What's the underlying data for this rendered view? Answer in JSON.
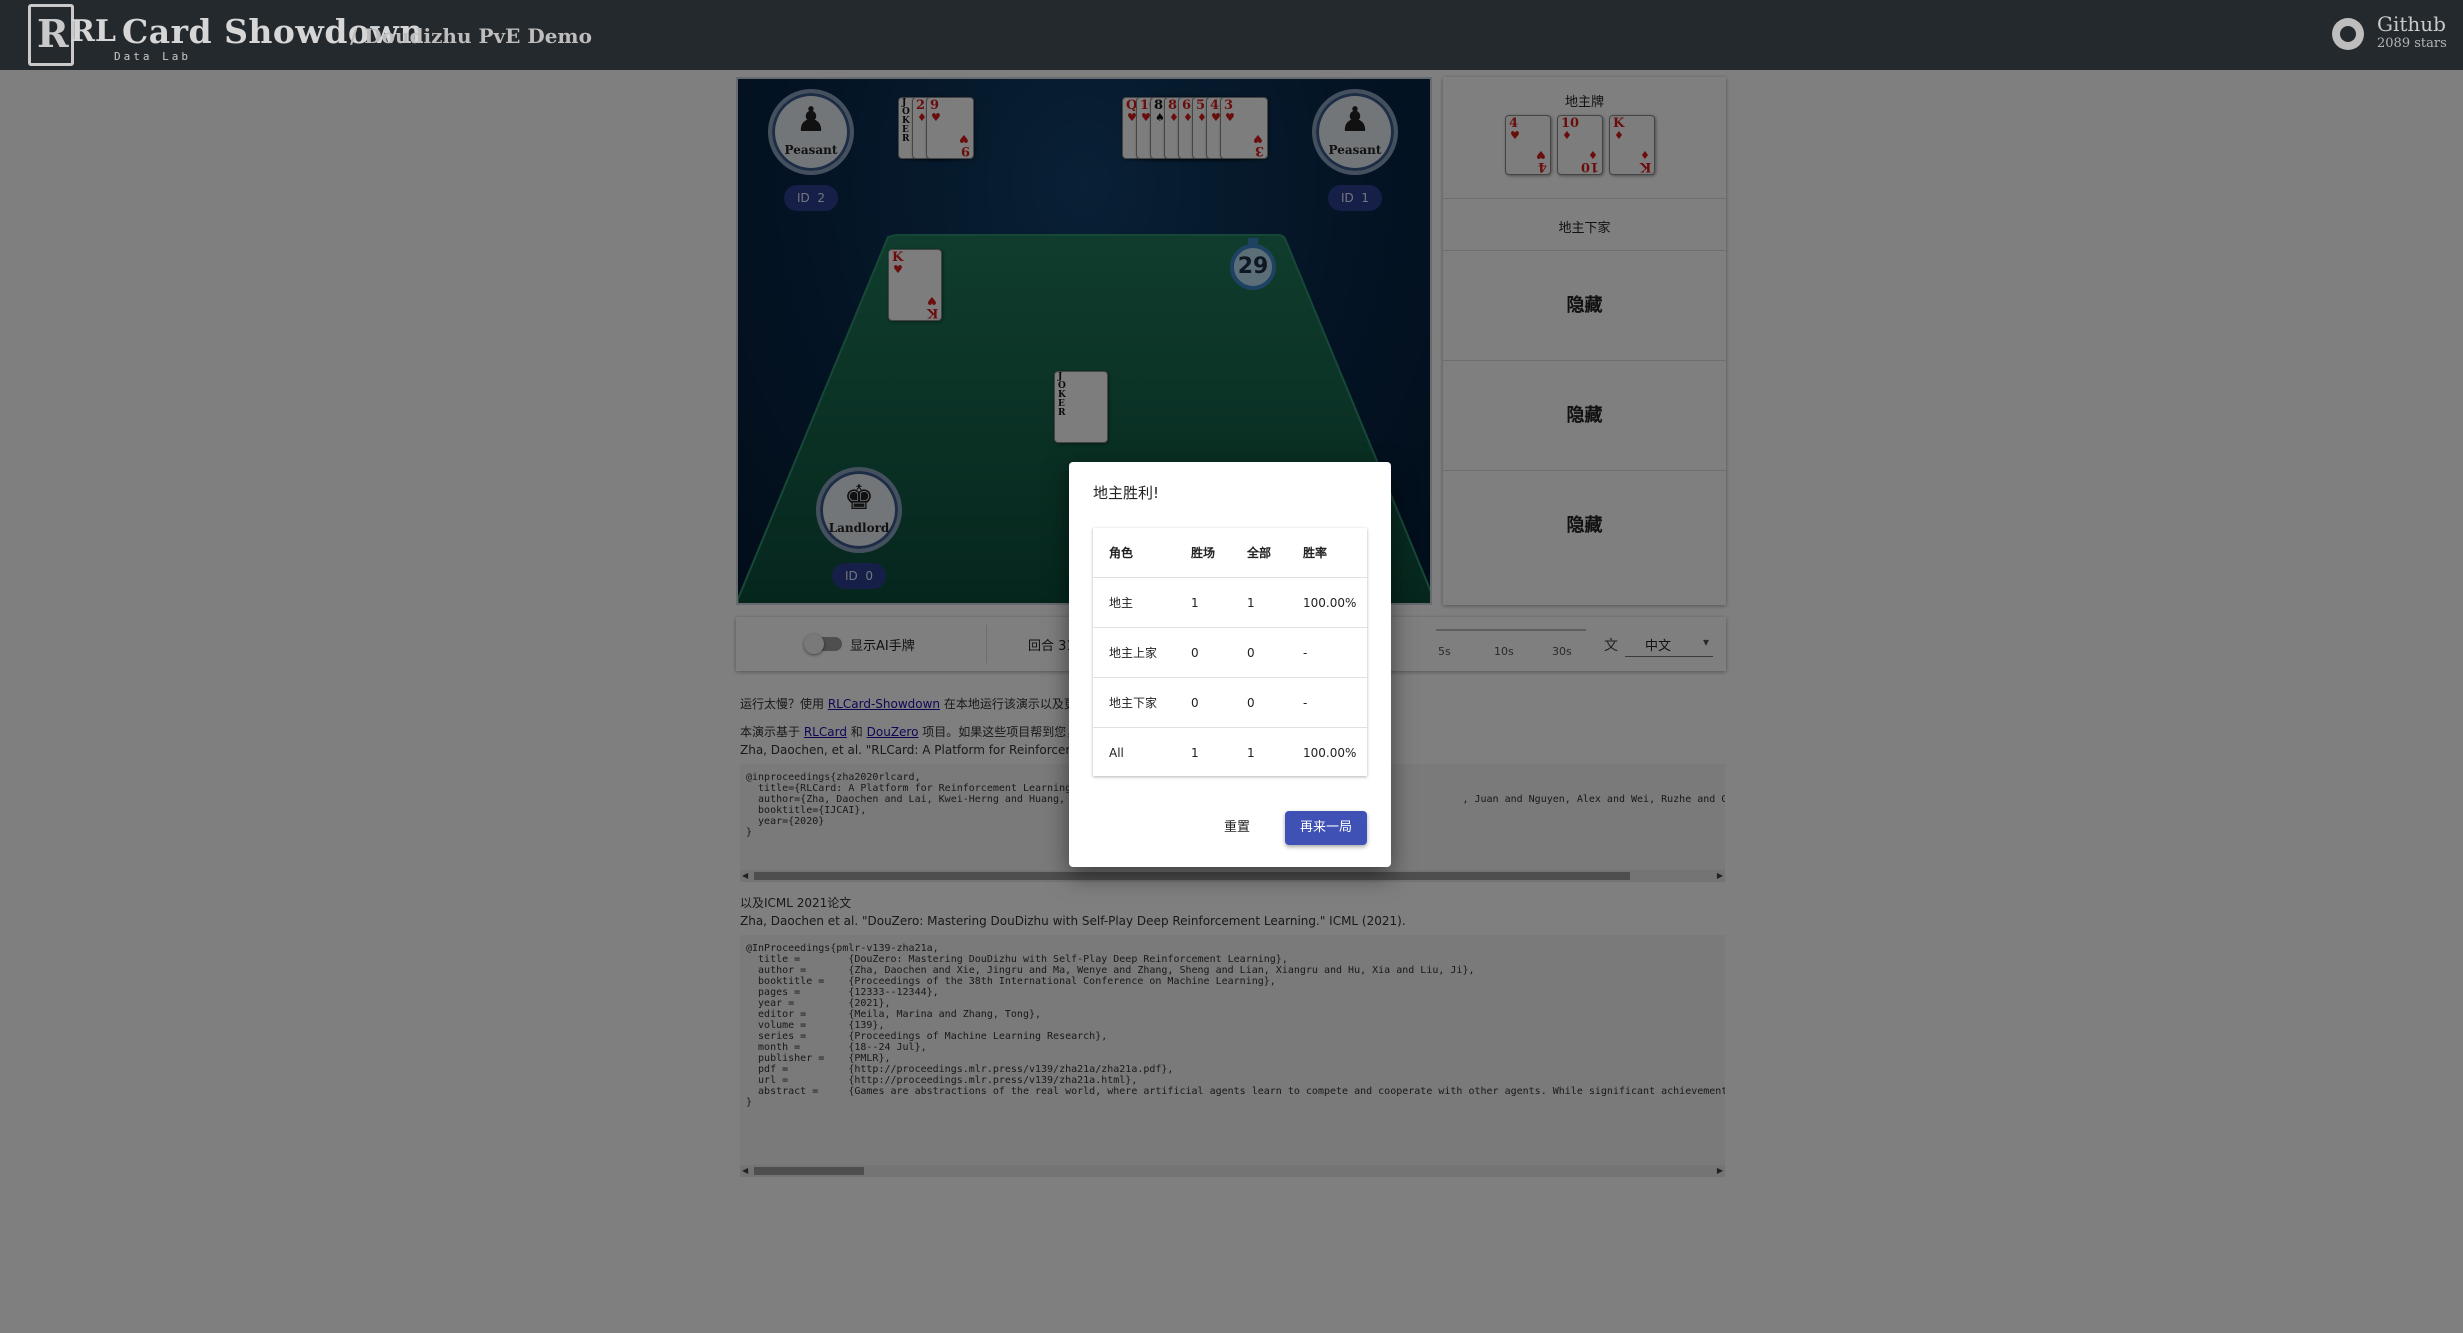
{
  "header": {
    "logo_letter": "R",
    "brand_rl": "RL",
    "brand_main": "Card Showdown",
    "brand_sub": "Data Lab",
    "demo_title": "/ Doudizhu PvE Demo",
    "github_label": "Github",
    "github_stars": "2089 stars"
  },
  "game": {
    "players": [
      {
        "role": "Peasant",
        "id_label": "ID",
        "id_value": "2"
      },
      {
        "role": "Peasant",
        "id_label": "ID",
        "id_value": "1"
      },
      {
        "role": "Landlord",
        "id_label": "ID",
        "id_value": "0"
      }
    ],
    "left_hand": [
      {
        "rank": "JOKER",
        "suit": "",
        "color": "black"
      },
      {
        "rank": "2",
        "suit": "♦",
        "color": "red"
      },
      {
        "rank": "9",
        "suit": "♥",
        "color": "red"
      }
    ],
    "right_hand": [
      {
        "rank": "Q",
        "suit": "♥",
        "color": "red"
      },
      {
        "rank": "10",
        "suit": "♥",
        "color": "red"
      },
      {
        "rank": "8",
        "suit": "♠",
        "color": "black"
      },
      {
        "rank": "8",
        "suit": "♦",
        "color": "red"
      },
      {
        "rank": "6",
        "suit": "♦",
        "color": "red"
      },
      {
        "rank": "5",
        "suit": "♦",
        "color": "red"
      },
      {
        "rank": "4",
        "suit": "♥",
        "color": "red"
      },
      {
        "rank": "3",
        "suit": "♥",
        "color": "red"
      }
    ],
    "played_card_1": {
      "rank": "K",
      "suit": "♥",
      "color": "red"
    },
    "played_card_2": {
      "rank": "JOKER",
      "suit": "",
      "color": "black"
    },
    "timer": "29"
  },
  "side_panel": {
    "landlord_cards_title": "地主牌",
    "landlord_cards": [
      {
        "rank": "4",
        "suit": "♥",
        "color": "red"
      },
      {
        "rank": "10",
        "suit": "♦",
        "color": "red"
      },
      {
        "rank": "K",
        "suit": "♦",
        "color": "red"
      }
    ],
    "next_player_label": "地主下家",
    "hidden_labels": [
      "隐藏",
      "隐藏",
      "隐藏"
    ]
  },
  "controls": {
    "show_ai_label": "显示AI手牌",
    "round_label": "回合 31",
    "speed_ticks": [
      "5s",
      "10s",
      "30s"
    ],
    "lang_icon": "translate-icon",
    "language": "中文"
  },
  "content": {
    "line1_pre": "运行太慢？使用",
    "line1_link": "RLCard-Showdown",
    "line1_post": "在本地运行该演示以及更",
    "line2_pre": "本演示基于",
    "line2_link1": "RLCard",
    "line2_mid": "和",
    "line2_link2": "DouZero",
    "line2_post": "项目。如果这些项目帮到您，",
    "line3": "Zha, Daochen, et al. \"RLCard: A Platform for Reinforcement L",
    "bibtex1": "@inproceedings{zha2020rlcard,\n  title={RLCard: A Platform for Reinforcement Learning\n  author={Zha, Daochen and Lai, Kwei-Herng and Huang,                                                                  , Juan and Nguyen, Alex and Wei, Ruzhe and Guo, Junyu a\n  booktitle={IJCAI},\n  year={2020}\n}",
    "line4": "以及ICML 2021论文",
    "line5": "Zha, Daochen et al. \"DouZero: Mastering DouDizhu with Self-Play Deep Reinforcement Learning.\" ICML (2021).",
    "bibtex2": "@InProceedings{pmlr-v139-zha21a,\n  title =        {DouZero: Mastering DouDizhu with Self-Play Deep Reinforcement Learning},\n  author =       {Zha, Daochen and Xie, Jingru and Ma, Wenye and Zhang, Sheng and Lian, Xiangru and Hu, Xia and Liu, Ji},\n  booktitle =    {Proceedings of the 38th International Conference on Machine Learning},\n  pages =        {12333--12344},\n  year =         {2021},\n  editor =       {Meila, Marina and Zhang, Tong},\n  volume =       {139},\n  series =       {Proceedings of Machine Learning Research},\n  month =        {18--24 Jul},\n  publisher =    {PMLR},\n  pdf =          {http://proceedings.mlr.press/v139/zha21a/zha21a.pdf},\n  url =          {http://proceedings.mlr.press/v139/zha21a.html},\n  abstract =     {Games are abstractions of the real world, where artificial agents learn to compete and cooperate with other agents. While significant achievement\n}"
  },
  "modal": {
    "title": "地主胜利!",
    "headers": [
      "角色",
      "胜场",
      "全部",
      "胜率"
    ],
    "rows": [
      [
        "地主",
        "1",
        "1",
        "100.00%"
      ],
      [
        "地主上家",
        "0",
        "0",
        "-"
      ],
      [
        "地主下家",
        "0",
        "0",
        "-"
      ],
      [
        "All",
        "1",
        "1",
        "100.00%"
      ]
    ],
    "reset_label": "重置",
    "again_label": "再来一局"
  }
}
